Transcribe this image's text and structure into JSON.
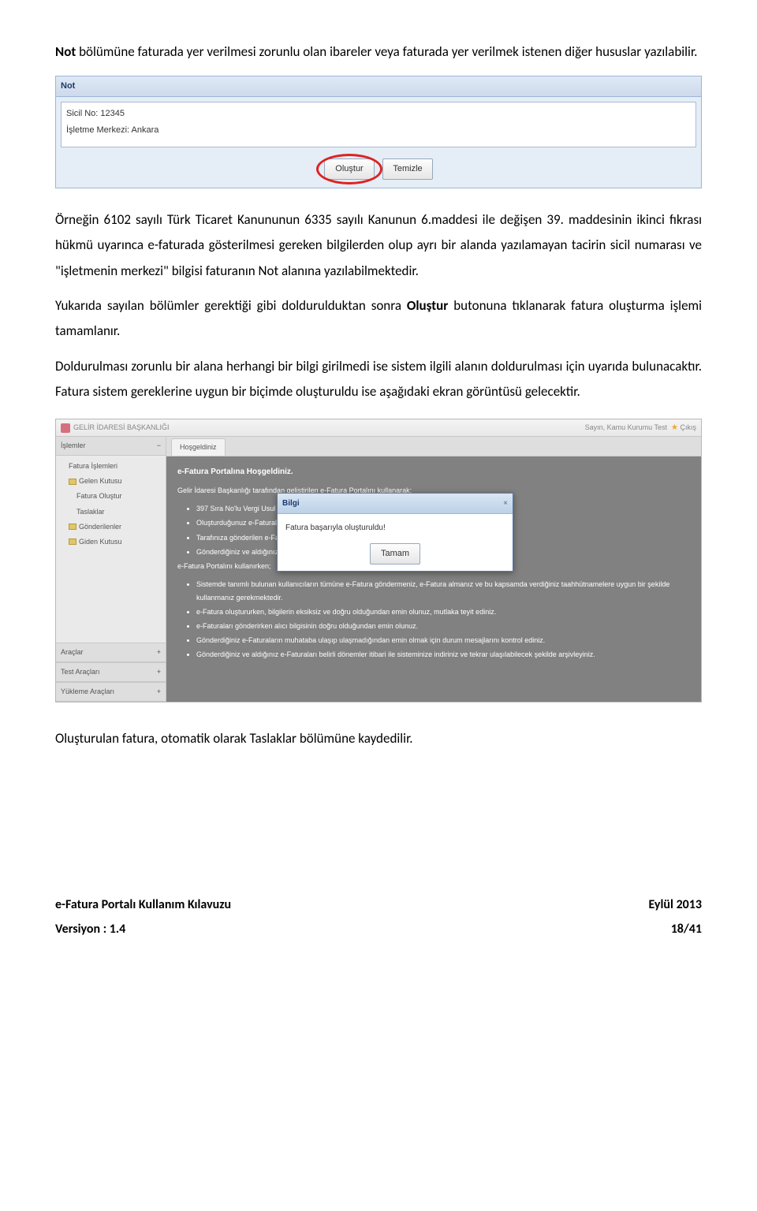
{
  "body": {
    "p1_prefix_bold": "Not",
    "p1_rest": " bölümüne faturada yer verilmesi zorunlu olan ibareler veya faturada yer verilmek istenen diğer hususlar yazılabilir.",
    "p2": "Örneğin 6102 sayılı Türk Ticaret Kanununun 6335 sayılı Kanunun 6.maddesi ile değişen 39. maddesinin ikinci fıkrası hükmü uyarınca e-faturada gösterilmesi gereken bilgilerden olup ayrı bir alanda yazılamayan tacirin sicil numarası ve \"işletmenin merkezi\" bilgisi faturanın Not alanına yazılabilmektedir.",
    "p3_pre": "Yukarıda sayılan bölümler gerektiği gibi doldurulduktan sonra ",
    "p3_bold": "Oluştur",
    "p3_post": " butonuna tıklanarak fatura oluşturma işlemi tamamlanır.",
    "p4": "Doldurulması zorunlu bir alana herhangi bir bilgi girilmedi ise sistem ilgili alanın doldurulması için uyarıda bulunacaktır. Fatura sistem gereklerine uygun bir biçimde oluşturuldu ise aşağıdaki ekran görüntüsü gelecektir.",
    "p5": "Oluşturulan fatura, otomatik olarak Taslaklar bölümüne kaydedilir."
  },
  "fig1": {
    "header": "Not",
    "textarea_value": "Sicil No: 12345\nİşletme Merkezi: Ankara",
    "btn_create": "Oluştur",
    "btn_clear": "Temizle"
  },
  "fig2": {
    "brand": "GELİR İDARESİ BAŞKANLIĞI",
    "user_label": "Sayın, Kamu Kurumu Test",
    "close_label": "Çıkış",
    "sidebar": {
      "header": "İşlemler",
      "items": [
        "Fatura İşlemleri",
        "Gelen Kutusu",
        "Fatura Oluştur",
        "Taslaklar",
        "Gönderilenler",
        "Giden Kutusu"
      ],
      "footer_items": [
        "Araçlar",
        "Test Araçları",
        "Yükleme Araçları"
      ]
    },
    "tab": "Hoşgeldiniz",
    "panel": {
      "title": "e-Fatura Portalına Hoşgeldiniz.",
      "intro": "Gelir İdaresi Başkanlığı tarafından geliştirilen e-Fatura Portalını kullanarak;",
      "bullets1": [
        "397 Sıra No'lu Vergi Usul Kanunu Genel Tebliği kapsamında e-Fatura oluşturabilir,",
        "Oluşturduğunuz e-Faturaları alıcılarına gönderebilir,",
        "Tarafınıza gönderilen e-Faturaları alabilir,",
        "Gönderdiğiniz ve aldığınız e-Faturaları elektronik ortamda muhafaza edebilirsiniz."
      ],
      "sub": "e-Fatura Portalını kullanırken;",
      "bullets2": [
        "Sistemde tanımlı bulunan kullanıcıların tümüne e-Fatura göndermeniz, e-Fatura almanız ve bu kapsamda verdiğiniz taahhütnamelere uygun bir şekilde kullanmanız gerekmektedir.",
        "e-Fatura oluştururken, bilgilerin eksiksiz ve doğru olduğundan emin olunuz, mutlaka teyit ediniz.",
        "e-Faturaları gönderirken alıcı bilgisinin doğru olduğundan emin olunuz.",
        "Gönderdiğiniz e-Faturaların muhataba ulaşıp ulaşmadığından emin olmak için durum mesajlarını kontrol ediniz.",
        "Gönderdiğiniz ve aldığınız e-Faturaları belirli dönemler itibari ile sisteminize indiriniz ve tekrar ulaşılabilecek şekilde arşivleyiniz."
      ]
    },
    "dialog": {
      "title": "Bilgi",
      "message": "Fatura başarıyla oluşturuldu!",
      "ok": "Tamam"
    }
  },
  "footer": {
    "doc_title": "e-Fatura Portalı Kullanım Kılavuzu",
    "version_label": "Versiyon : 1.4",
    "date": "Eylül 2013",
    "page": "18/41"
  }
}
